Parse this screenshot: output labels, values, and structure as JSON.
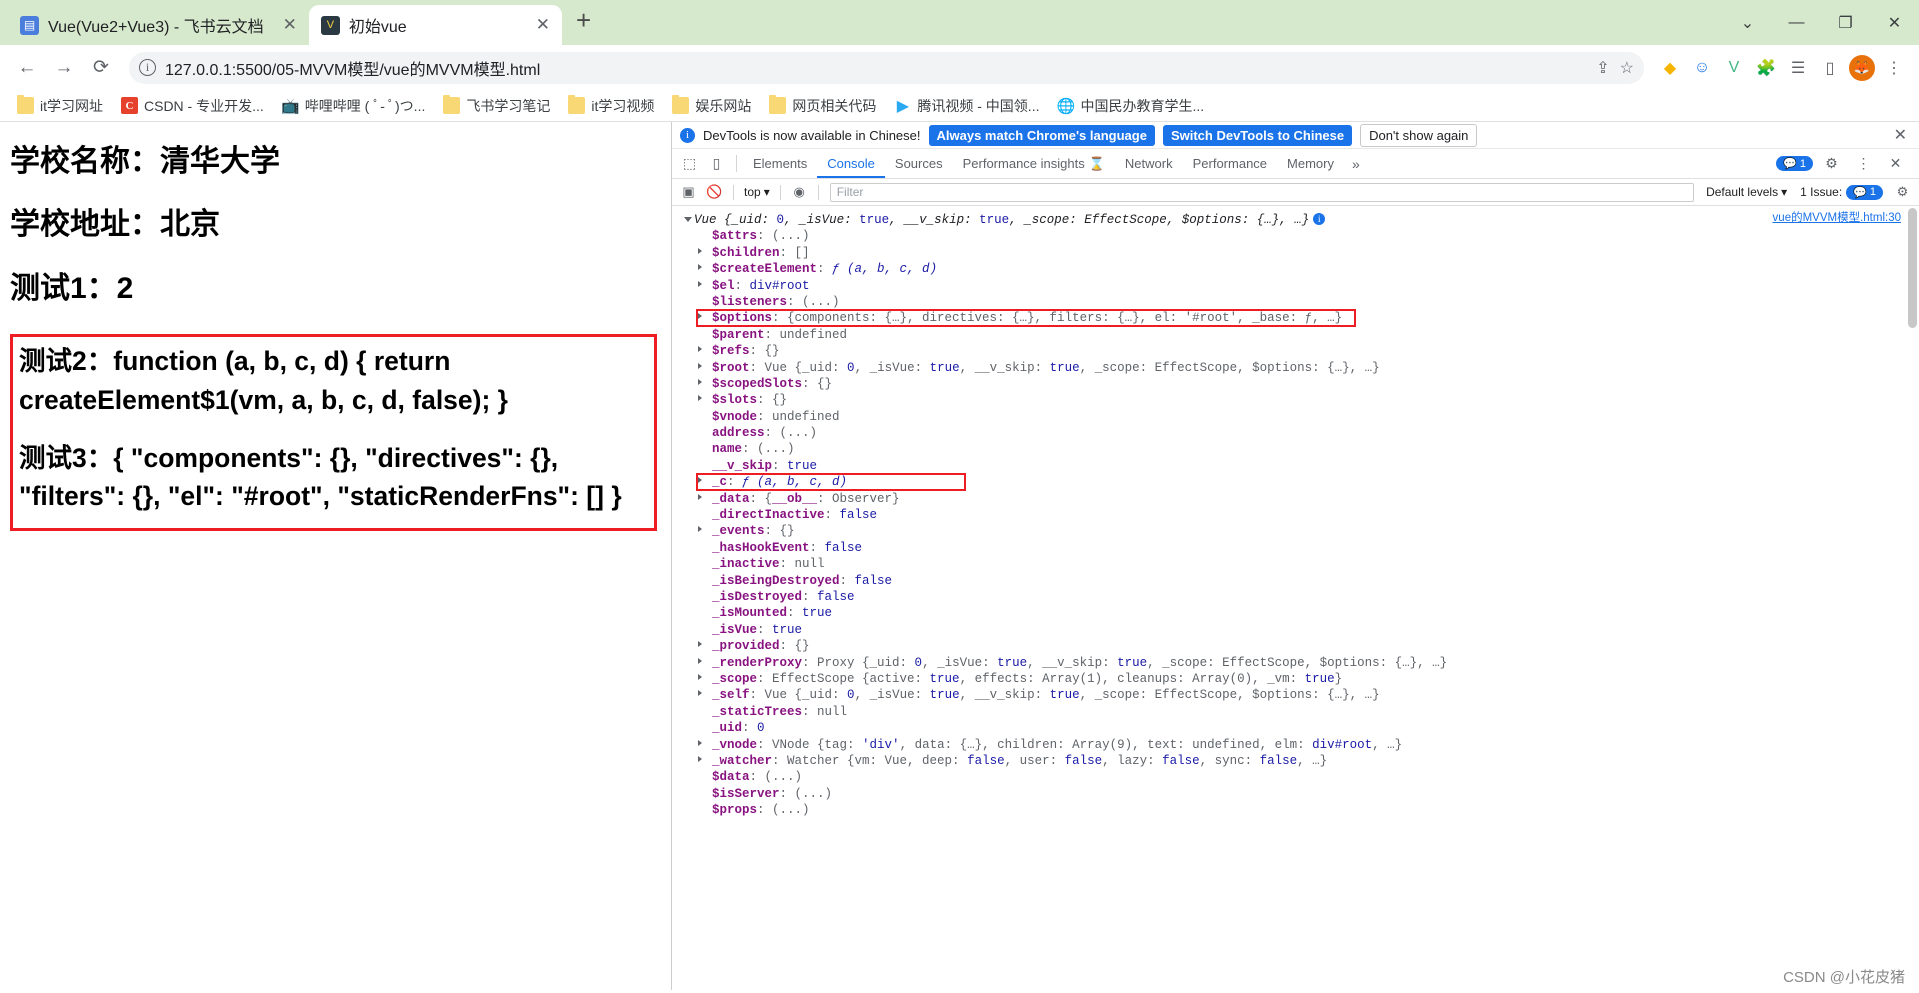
{
  "browser": {
    "tabs": [
      {
        "title": "Vue(Vue2+Vue3) - 飞书云文档",
        "icon": "doc-icon",
        "active": false,
        "close": "✕"
      },
      {
        "title": "初始vue",
        "icon": "vue-icon",
        "active": true,
        "close": "✕"
      }
    ],
    "new_tab_label": "+",
    "window_controls": {
      "minimize_group": "⌄",
      "minimize": "—",
      "maximize": "❐",
      "close": "✕"
    },
    "nav": {
      "back": "←",
      "forward": "→",
      "reload": "⟳"
    },
    "omnibox": {
      "info_icon": "ⓘ",
      "url": "127.0.0.1:5500/05-MVVM模型/vue的MVVM模型.html",
      "share_icon": "share-icon",
      "star_icon": "☆"
    },
    "extensions": [
      "puzzle-icon",
      "smiley-icon",
      "v-icon",
      "puzzle2-icon",
      "list-icon",
      "sidepanel-icon"
    ],
    "profile_initial": "",
    "bookmarks": [
      {
        "label": "it学习网址",
        "icon": "folder"
      },
      {
        "label": "CSDN - 专业开发...",
        "icon": "csdn"
      },
      {
        "label": "哔哩哔哩 ( ﾟ- ﾟ)つ...",
        "icon": "bili"
      },
      {
        "label": "飞书学习笔记",
        "icon": "folder"
      },
      {
        "label": "it学习视频",
        "icon": "folder"
      },
      {
        "label": "娱乐网站",
        "icon": "folder"
      },
      {
        "label": "网页相关代码",
        "icon": "folder"
      },
      {
        "label": "腾讯视频 - 中国领...",
        "icon": "tencent"
      },
      {
        "label": "中国民办教育学生...",
        "icon": "globe"
      }
    ]
  },
  "webpage": {
    "lines": [
      "学校名称：清华大学",
      "学校地址：北京",
      "测试1：2"
    ],
    "highlighted_code": [
      "测试2：function (a, b, c, d) { return createElement$1(vm, a, b, c, d, false); }",
      "测试3：{ \"components\": {}, \"directives\": {}, \"filters\": {}, \"el\": \"#root\", \"staticRenderFns\": [] }"
    ]
  },
  "devtools": {
    "notice": {
      "text": "DevTools is now available in Chinese!",
      "btn_always": "Always match Chrome's language",
      "btn_switch": "Switch DevTools to Chinese",
      "btn_dismiss": "Don't show again",
      "close": "✕"
    },
    "tabs": [
      {
        "label": "Elements",
        "active": false
      },
      {
        "label": "Console",
        "active": true
      },
      {
        "label": "Sources",
        "active": false
      },
      {
        "label": "Performance insights",
        "active": false,
        "badge": "flask-icon"
      },
      {
        "label": "Network",
        "active": false
      },
      {
        "label": "Performance",
        "active": false
      },
      {
        "label": "Memory",
        "active": false
      }
    ],
    "more": "»",
    "header_right": {
      "messages_count": "1",
      "settings": "gear-icon",
      "kebab": "⋮",
      "close": "✕"
    },
    "filterbar": {
      "context": "top",
      "filter_placeholder": "Filter",
      "levels": "Default levels",
      "issues": "1 Issue:",
      "issues_count": "1"
    },
    "source_link": "vue的MVVM模型.html:30",
    "console": [
      {
        "indent": 0,
        "arrow": "down",
        "segments": [
          {
            "t": "Vue {",
            "c": "objhead"
          },
          {
            "t": "_uid",
            "c": "it"
          },
          {
            "t": ": ",
            "c": "objhead"
          },
          {
            "t": "0",
            "c": "n"
          },
          {
            "t": ", ",
            "c": "objhead"
          },
          {
            "t": "_isVue",
            "c": "it"
          },
          {
            "t": ": ",
            "c": "objhead"
          },
          {
            "t": "true",
            "c": "b"
          },
          {
            "t": ", ",
            "c": "objhead"
          },
          {
            "t": "__v_skip",
            "c": "it"
          },
          {
            "t": ": ",
            "c": "objhead"
          },
          {
            "t": "true",
            "c": "b"
          },
          {
            "t": ", ",
            "c": "objhead"
          },
          {
            "t": "_scope",
            "c": "it"
          },
          {
            "t": ": ",
            "c": "objhead"
          },
          {
            "t": "EffectScope",
            "c": "it"
          },
          {
            "t": ", ",
            "c": "objhead"
          },
          {
            "t": "$options",
            "c": "it"
          },
          {
            "t": ": {…}, …}",
            "c": "objhead"
          }
        ],
        "info": true
      },
      {
        "indent": 1,
        "arrow": "none",
        "segments": [
          {
            "t": "$attrs",
            "c": "k"
          },
          {
            "t": ": ",
            "c": "g"
          },
          {
            "t": "(...)",
            "c": "s"
          }
        ]
      },
      {
        "indent": 1,
        "arrow": "right",
        "segments": [
          {
            "t": "$children",
            "c": "k"
          },
          {
            "t": ": ",
            "c": "g"
          },
          {
            "t": "[]",
            "c": "g"
          }
        ]
      },
      {
        "indent": 1,
        "arrow": "right",
        "segments": [
          {
            "t": "$createElement",
            "c": "k"
          },
          {
            "t": ": ",
            "c": "g"
          },
          {
            "t": "ƒ (a, b, c, d)",
            "c": "fnk"
          }
        ]
      },
      {
        "indent": 1,
        "arrow": "right",
        "segments": [
          {
            "t": "$el",
            "c": "k"
          },
          {
            "t": ": ",
            "c": "g"
          },
          {
            "t": "div#root",
            "c": "elref"
          }
        ]
      },
      {
        "indent": 1,
        "arrow": "none",
        "segments": [
          {
            "t": "$listeners",
            "c": "k"
          },
          {
            "t": ": ",
            "c": "g"
          },
          {
            "t": "(...)",
            "c": "s"
          }
        ]
      },
      {
        "indent": 1,
        "arrow": "right",
        "highlight": "options",
        "segments": [
          {
            "t": "$options",
            "c": "k"
          },
          {
            "t": ": {components: {…}, directives: {…}, filters: {…}, el: '#root', _base: ƒ, …}",
            "c": "g"
          }
        ]
      },
      {
        "indent": 1,
        "arrow": "none",
        "segments": [
          {
            "t": "$parent",
            "c": "k"
          },
          {
            "t": ": ",
            "c": "g"
          },
          {
            "t": "undefined",
            "c": "s"
          }
        ]
      },
      {
        "indent": 1,
        "arrow": "right",
        "segments": [
          {
            "t": "$refs",
            "c": "k"
          },
          {
            "t": ": ",
            "c": "g"
          },
          {
            "t": "{}",
            "c": "g"
          }
        ]
      },
      {
        "indent": 1,
        "arrow": "right",
        "segments": [
          {
            "t": "$root",
            "c": "k"
          },
          {
            "t": ": Vue {_uid: ",
            "c": "g"
          },
          {
            "t": "0",
            "c": "n"
          },
          {
            "t": ", _isVue: ",
            "c": "g"
          },
          {
            "t": "true",
            "c": "b"
          },
          {
            "t": ", __v_skip: ",
            "c": "g"
          },
          {
            "t": "true",
            "c": "b"
          },
          {
            "t": ", _scope: EffectScope, $options: {…}, …}",
            "c": "g"
          }
        ]
      },
      {
        "indent": 1,
        "arrow": "right",
        "segments": [
          {
            "t": "$scopedSlots",
            "c": "k"
          },
          {
            "t": ": ",
            "c": "g"
          },
          {
            "t": "{}",
            "c": "g"
          }
        ]
      },
      {
        "indent": 1,
        "arrow": "right",
        "segments": [
          {
            "t": "$slots",
            "c": "k"
          },
          {
            "t": ": ",
            "c": "g"
          },
          {
            "t": "{}",
            "c": "g"
          }
        ]
      },
      {
        "indent": 1,
        "arrow": "none",
        "segments": [
          {
            "t": "$vnode",
            "c": "k"
          },
          {
            "t": ": ",
            "c": "g"
          },
          {
            "t": "undefined",
            "c": "s"
          }
        ]
      },
      {
        "indent": 1,
        "arrow": "none",
        "segments": [
          {
            "t": "address",
            "c": "k"
          },
          {
            "t": ": ",
            "c": "g"
          },
          {
            "t": "(...)",
            "c": "s"
          }
        ]
      },
      {
        "indent": 1,
        "arrow": "none",
        "segments": [
          {
            "t": "name",
            "c": "k"
          },
          {
            "t": ": ",
            "c": "g"
          },
          {
            "t": "(...)",
            "c": "s"
          }
        ]
      },
      {
        "indent": 1,
        "arrow": "none",
        "segments": [
          {
            "t": "__v_skip",
            "c": "k"
          },
          {
            "t": ": ",
            "c": "g"
          },
          {
            "t": "true",
            "c": "b"
          }
        ]
      },
      {
        "indent": 1,
        "arrow": "right",
        "highlight": "c",
        "segments": [
          {
            "t": "_c",
            "c": "k"
          },
          {
            "t": ": ",
            "c": "g"
          },
          {
            "t": "ƒ (a, b, c, d)",
            "c": "fnk"
          }
        ]
      },
      {
        "indent": 1,
        "arrow": "right",
        "segments": [
          {
            "t": "_data",
            "c": "k"
          },
          {
            "t": ": {",
            "c": "g"
          },
          {
            "t": "__ob__",
            "c": "k"
          },
          {
            "t": ": Observer}",
            "c": "g"
          }
        ]
      },
      {
        "indent": 1,
        "arrow": "none",
        "segments": [
          {
            "t": "_directInactive",
            "c": "k"
          },
          {
            "t": ": ",
            "c": "g"
          },
          {
            "t": "false",
            "c": "b"
          }
        ]
      },
      {
        "indent": 1,
        "arrow": "right",
        "segments": [
          {
            "t": "_events",
            "c": "k"
          },
          {
            "t": ": ",
            "c": "g"
          },
          {
            "t": "{}",
            "c": "g"
          }
        ]
      },
      {
        "indent": 1,
        "arrow": "none",
        "segments": [
          {
            "t": "_hasHookEvent",
            "c": "k"
          },
          {
            "t": ": ",
            "c": "g"
          },
          {
            "t": "false",
            "c": "b"
          }
        ]
      },
      {
        "indent": 1,
        "arrow": "none",
        "segments": [
          {
            "t": "_inactive",
            "c": "k"
          },
          {
            "t": ": ",
            "c": "g"
          },
          {
            "t": "null",
            "c": "s"
          }
        ]
      },
      {
        "indent": 1,
        "arrow": "none",
        "segments": [
          {
            "t": "_isBeingDestroyed",
            "c": "k"
          },
          {
            "t": ": ",
            "c": "g"
          },
          {
            "t": "false",
            "c": "b"
          }
        ]
      },
      {
        "indent": 1,
        "arrow": "none",
        "segments": [
          {
            "t": "_isDestroyed",
            "c": "k"
          },
          {
            "t": ": ",
            "c": "g"
          },
          {
            "t": "false",
            "c": "b"
          }
        ]
      },
      {
        "indent": 1,
        "arrow": "none",
        "segments": [
          {
            "t": "_isMounted",
            "c": "k"
          },
          {
            "t": ": ",
            "c": "g"
          },
          {
            "t": "true",
            "c": "b"
          }
        ]
      },
      {
        "indent": 1,
        "arrow": "none",
        "segments": [
          {
            "t": "_isVue",
            "c": "k"
          },
          {
            "t": ": ",
            "c": "g"
          },
          {
            "t": "true",
            "c": "b"
          }
        ]
      },
      {
        "indent": 1,
        "arrow": "right",
        "segments": [
          {
            "t": "_provided",
            "c": "k"
          },
          {
            "t": ": ",
            "c": "g"
          },
          {
            "t": "{}",
            "c": "g"
          }
        ]
      },
      {
        "indent": 1,
        "arrow": "right",
        "segments": [
          {
            "t": "_renderProxy",
            "c": "k"
          },
          {
            "t": ": Proxy {_uid: ",
            "c": "g"
          },
          {
            "t": "0",
            "c": "n"
          },
          {
            "t": ", _isVue: ",
            "c": "g"
          },
          {
            "t": "true",
            "c": "b"
          },
          {
            "t": ", __v_skip: ",
            "c": "g"
          },
          {
            "t": "true",
            "c": "b"
          },
          {
            "t": ", _scope: EffectScope, $options: {…}, …}",
            "c": "g"
          }
        ]
      },
      {
        "indent": 1,
        "arrow": "right",
        "segments": [
          {
            "t": "_scope",
            "c": "k"
          },
          {
            "t": ": EffectScope {active: ",
            "c": "g"
          },
          {
            "t": "true",
            "c": "b"
          },
          {
            "t": ", effects: Array(1), cleanups: Array(0), _vm: ",
            "c": "g"
          },
          {
            "t": "true",
            "c": "b"
          },
          {
            "t": "}",
            "c": "g"
          }
        ]
      },
      {
        "indent": 1,
        "arrow": "right",
        "segments": [
          {
            "t": "_self",
            "c": "k"
          },
          {
            "t": ": Vue {_uid: ",
            "c": "g"
          },
          {
            "t": "0",
            "c": "n"
          },
          {
            "t": ", _isVue: ",
            "c": "g"
          },
          {
            "t": "true",
            "c": "b"
          },
          {
            "t": ", __v_skip: ",
            "c": "g"
          },
          {
            "t": "true",
            "c": "b"
          },
          {
            "t": ", _scope: EffectScope, $options: {…}, …}",
            "c": "g"
          }
        ]
      },
      {
        "indent": 1,
        "arrow": "none",
        "segments": [
          {
            "t": "_staticTrees",
            "c": "k"
          },
          {
            "t": ": ",
            "c": "g"
          },
          {
            "t": "null",
            "c": "s"
          }
        ]
      },
      {
        "indent": 1,
        "arrow": "none",
        "segments": [
          {
            "t": "_uid",
            "c": "k"
          },
          {
            "t": ": ",
            "c": "g"
          },
          {
            "t": "0",
            "c": "n"
          }
        ]
      },
      {
        "indent": 1,
        "arrow": "right",
        "segments": [
          {
            "t": "_vnode",
            "c": "k"
          },
          {
            "t": ": VNode {tag: ",
            "c": "g"
          },
          {
            "t": "'div'",
            "c": "elref"
          },
          {
            "t": ", data: {…}, children: Array(9), text: ",
            "c": "g"
          },
          {
            "t": "undefined",
            "c": "s"
          },
          {
            "t": ", elm: ",
            "c": "g"
          },
          {
            "t": "div#root",
            "c": "elref"
          },
          {
            "t": ", …}",
            "c": "g"
          }
        ]
      },
      {
        "indent": 1,
        "arrow": "right",
        "segments": [
          {
            "t": "_watcher",
            "c": "k"
          },
          {
            "t": ": Watcher {vm: Vue, deep: ",
            "c": "g"
          },
          {
            "t": "false",
            "c": "b"
          },
          {
            "t": ", user: ",
            "c": "g"
          },
          {
            "t": "false",
            "c": "b"
          },
          {
            "t": ", lazy: ",
            "c": "g"
          },
          {
            "t": "false",
            "c": "b"
          },
          {
            "t": ", sync: ",
            "c": "g"
          },
          {
            "t": "false",
            "c": "b"
          },
          {
            "t": ", …}",
            "c": "g"
          }
        ]
      },
      {
        "indent": 1,
        "arrow": "none",
        "segments": [
          {
            "t": "$data",
            "c": "k"
          },
          {
            "t": ": ",
            "c": "g"
          },
          {
            "t": "(...)",
            "c": "s"
          }
        ]
      },
      {
        "indent": 1,
        "arrow": "none",
        "segments": [
          {
            "t": "$isServer",
            "c": "k"
          },
          {
            "t": ": ",
            "c": "g"
          },
          {
            "t": "(...)",
            "c": "s"
          }
        ]
      },
      {
        "indent": 1,
        "arrow": "none",
        "segments": [
          {
            "t": "$props",
            "c": "k"
          },
          {
            "t": ": ",
            "c": "g"
          },
          {
            "t": "(...)",
            "c": "s"
          }
        ]
      }
    ]
  },
  "watermark": "CSDN @小花皮猪"
}
